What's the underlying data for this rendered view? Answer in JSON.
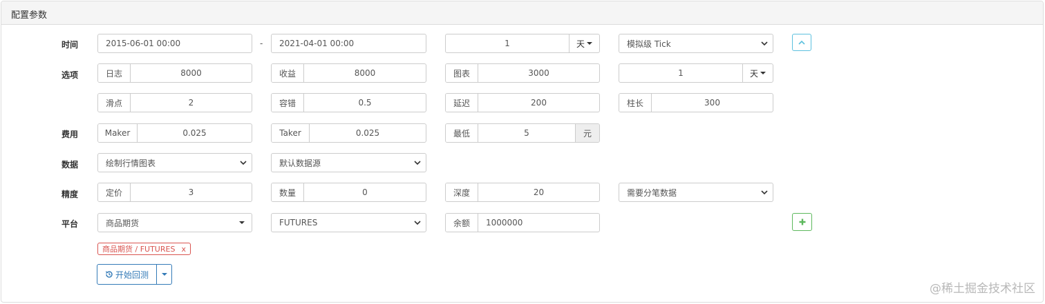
{
  "panel": {
    "title": "配置参数"
  },
  "labels": {
    "time": "时间",
    "options": "选项",
    "fees": "费用",
    "data": "数据",
    "precision": "精度",
    "platform": "平台"
  },
  "time": {
    "start": "2015-06-01 00:00",
    "separator": "-",
    "end": "2021-04-01 00:00",
    "period_value": "1",
    "period_unit": "天",
    "mode": "模拟级 Tick"
  },
  "options_row1": {
    "log_label": "日志",
    "log_value": "8000",
    "profit_label": "收益",
    "profit_value": "8000",
    "chart_label": "图表",
    "chart_value": "3000",
    "kline_value": "1",
    "kline_unit": "天"
  },
  "options_row2": {
    "slippage_label": "滑点",
    "slippage_value": "2",
    "tolerance_label": "容错",
    "tolerance_value": "0.5",
    "delay_label": "延迟",
    "delay_value": "200",
    "bar_label": "柱长",
    "bar_value": "300"
  },
  "fees": {
    "maker_label": "Maker",
    "maker_value": "0.025",
    "taker_label": "Taker",
    "taker_value": "0.025",
    "min_label": "最低",
    "min_value": "5",
    "min_unit": "元"
  },
  "data": {
    "chart_mode": "绘制行情图表",
    "source": "默认数据源"
  },
  "precision": {
    "price_label": "定价",
    "price_value": "3",
    "qty_label": "数量",
    "qty_value": "0",
    "depth_label": "深度",
    "depth_value": "20",
    "trades_mode": "需要分笔数据"
  },
  "platform": {
    "exchange": "商品期货",
    "contract": "FUTURES",
    "balance_label": "余额",
    "balance_value": "1000000"
  },
  "tag": {
    "label": "商品期货 / FUTURES",
    "remove": "x"
  },
  "actions": {
    "start_label": "开始回测"
  },
  "watermark": "@稀土掘金技术社区",
  "colors": {
    "primary": "#337ab7",
    "success": "#5cb85c",
    "danger": "#d9534f",
    "info": "#5bc0de"
  }
}
